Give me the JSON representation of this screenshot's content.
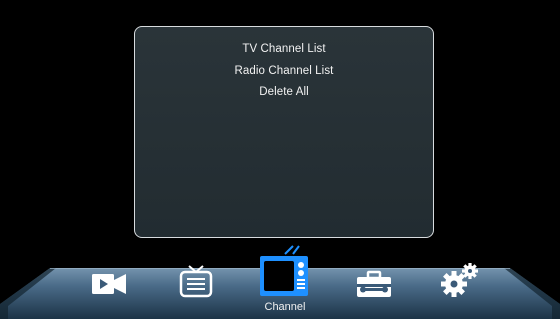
{
  "menu": {
    "items": [
      {
        "label": "TV Channel List"
      },
      {
        "label": "Radio Channel List"
      },
      {
        "label": "Delete All"
      }
    ]
  },
  "bottom_nav": {
    "items": [
      {
        "icon": "media-camera-icon"
      },
      {
        "icon": "program-guide-tv-icon"
      },
      {
        "icon": "channel-tv-icon",
        "active": true
      },
      {
        "icon": "toolbox-icon"
      },
      {
        "icon": "gears-icon"
      }
    ],
    "active_label": "Channel"
  },
  "colors": {
    "background": "#000000",
    "panel": "#263035",
    "panel_border": "#d8dcdf",
    "bar_light": "#6a8aa6",
    "bar_dark": "#1e3448",
    "active_icon": "#1e90ff",
    "text": "#f2f2f2"
  }
}
